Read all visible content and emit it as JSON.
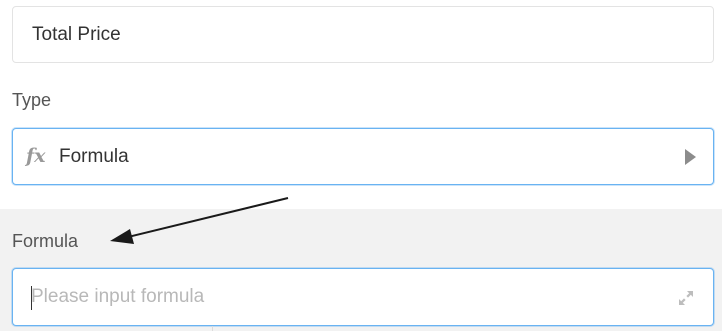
{
  "column_name": {
    "value": "Total Price"
  },
  "type_section": {
    "label": "Type",
    "icon": "fx-icon",
    "selected_value": "Formula",
    "dropdown_icon": "caret-right-icon"
  },
  "formula_section": {
    "label": "Formula",
    "placeholder": "Please input formula",
    "value": "",
    "expand_icon": "expand-icon"
  },
  "colors": {
    "focus_border": "#69b3f2",
    "section_background": "#f2f2f2",
    "placeholder_text": "#b8b8b8",
    "icon_gray": "#8c8c8c"
  }
}
